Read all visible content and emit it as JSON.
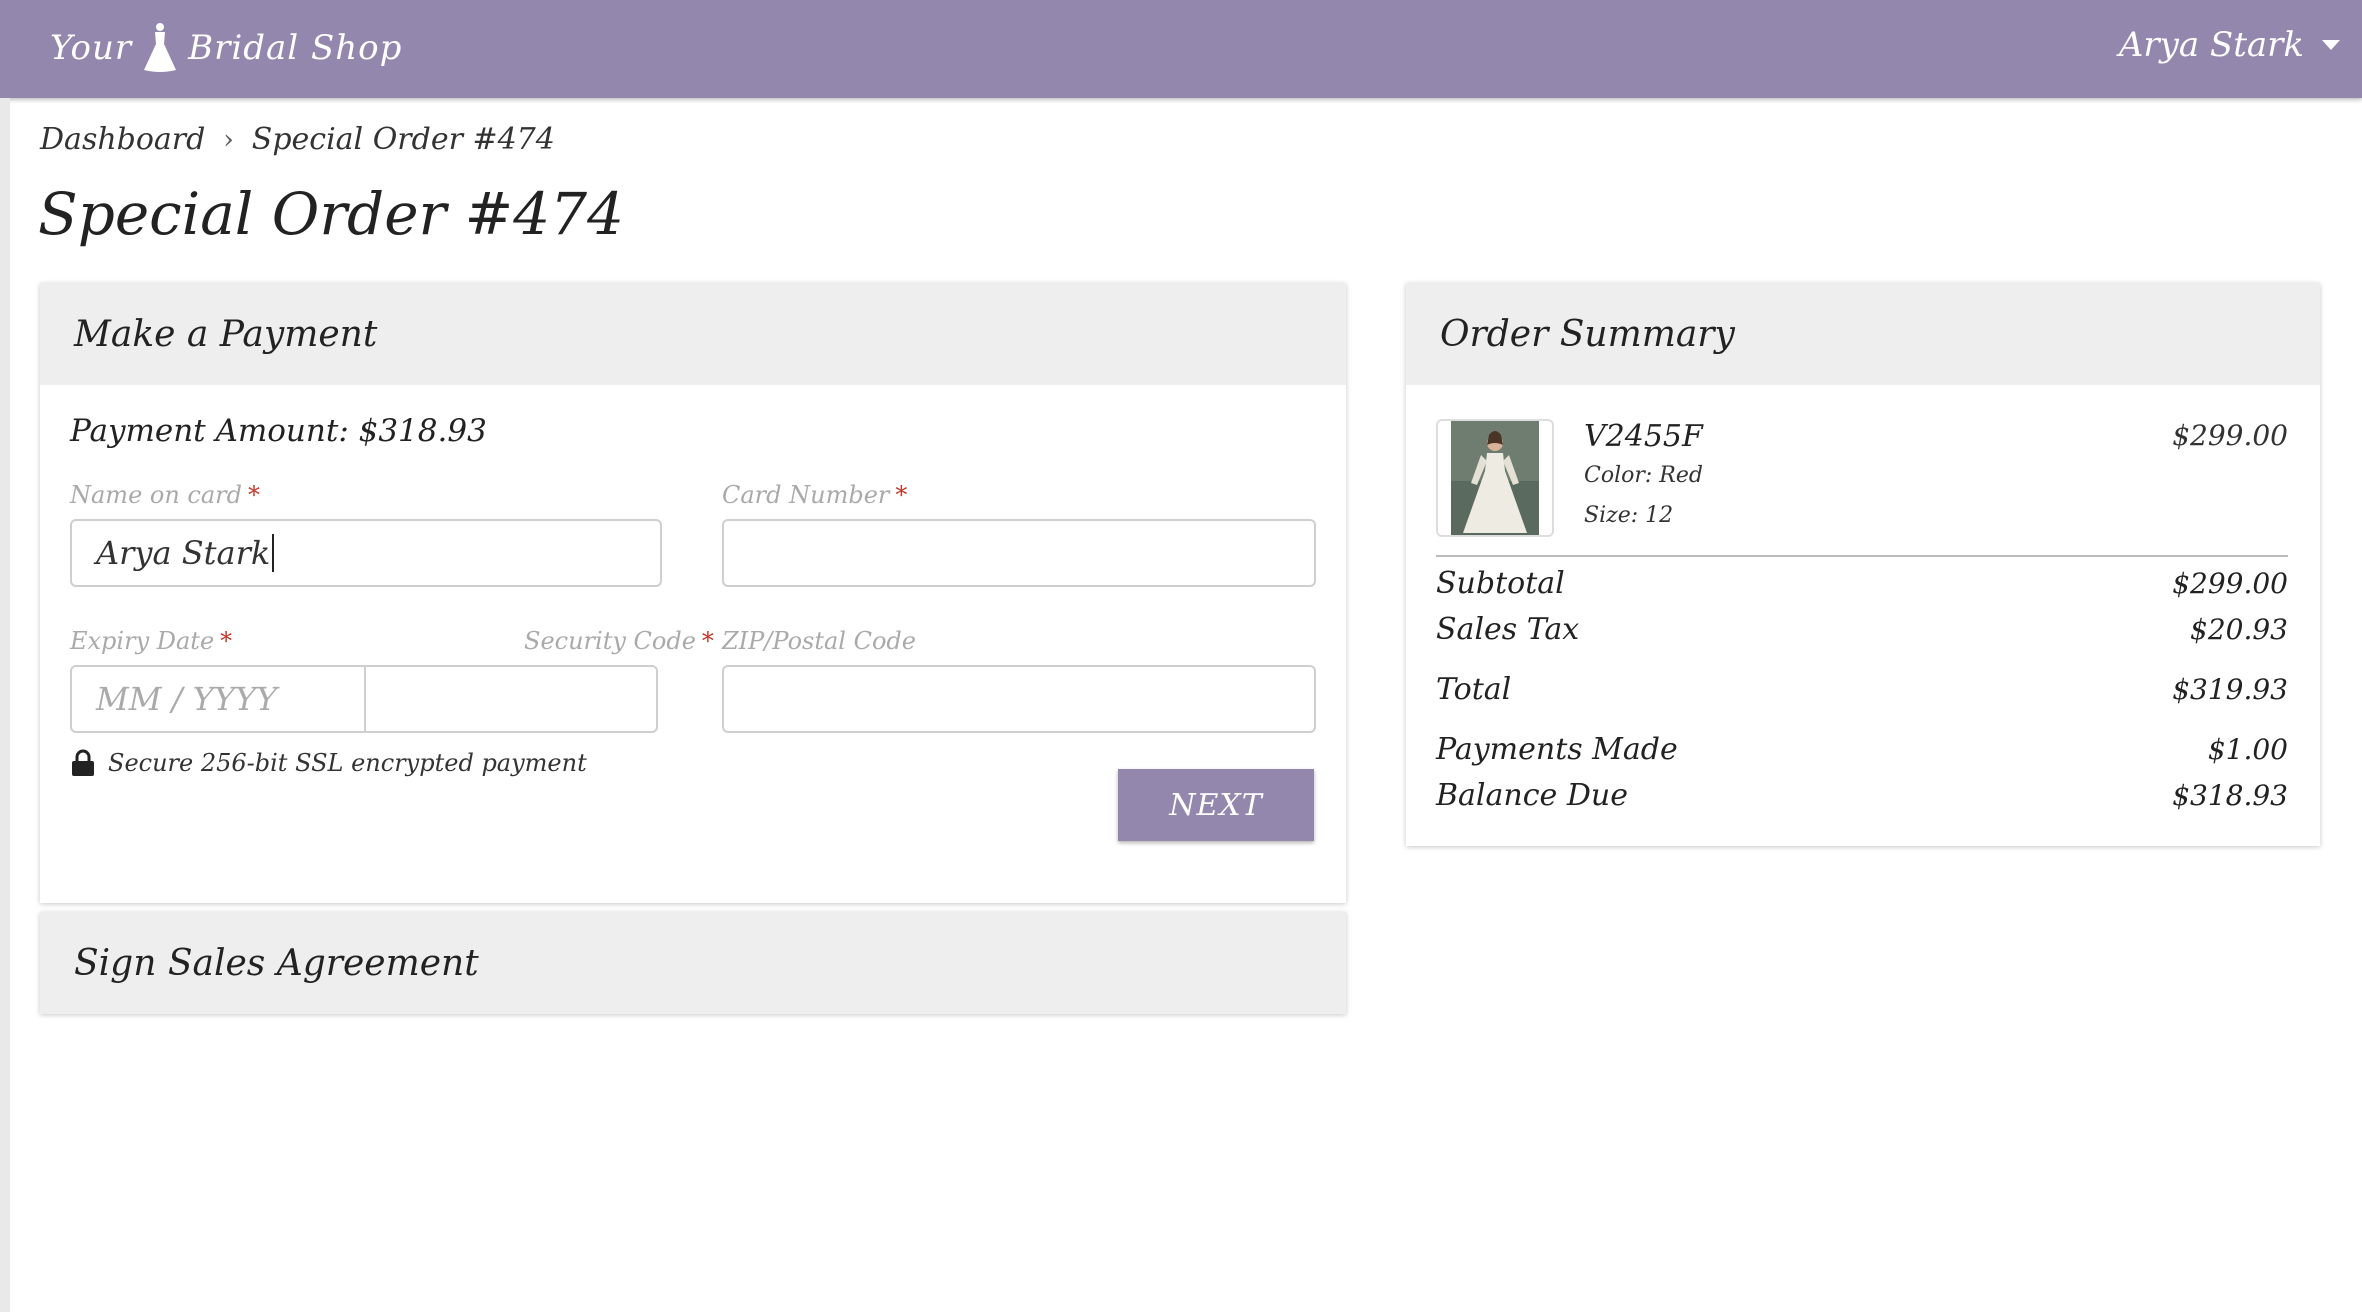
{
  "header": {
    "logo_left": "Your",
    "logo_right": "Bridal Shop",
    "user_name": "Arya Stark"
  },
  "breadcrumb": {
    "home": "Dashboard",
    "current": "Special Order #474"
  },
  "page": {
    "title": "Special Order #474"
  },
  "payment": {
    "header": "Make a Payment",
    "amount_text": "Payment Amount: $318.93",
    "name_label": "Name on card",
    "name_value": "Arya Stark",
    "card_label": "Card Number",
    "card_value": "",
    "expiry_label": "Expiry Date",
    "expiry_placeholder": "MM / YYYY",
    "security_label": "Security Code",
    "zip_label": "ZIP/Postal Code",
    "zip_value": "",
    "required_mark": "*",
    "secure_text": "Secure 256-bit SSL encrypted payment",
    "next_label": "NEXT"
  },
  "agreement": {
    "header": "Sign Sales Agreement"
  },
  "summary": {
    "header": "Order Summary",
    "item": {
      "name": "V2455F",
      "color": "Color: Red",
      "size": "Size: 12",
      "price": "$299.00"
    },
    "rows": [
      {
        "label": "Subtotal",
        "value": "$299.00"
      },
      {
        "label": "Sales Tax",
        "value": "$20.93"
      },
      {
        "label": "Total",
        "value": "$319.93"
      },
      {
        "label": "Payments Made",
        "value": "$1.00"
      },
      {
        "label": "Balance Due",
        "value": "$318.93"
      }
    ]
  },
  "colors": {
    "brand": "#9387ad",
    "panel_header": "#eeeeee",
    "required": "#c0392b"
  },
  "icons": {
    "logo": "dress-icon",
    "user_menu": "caret-down-icon",
    "secure": "lock-icon"
  }
}
